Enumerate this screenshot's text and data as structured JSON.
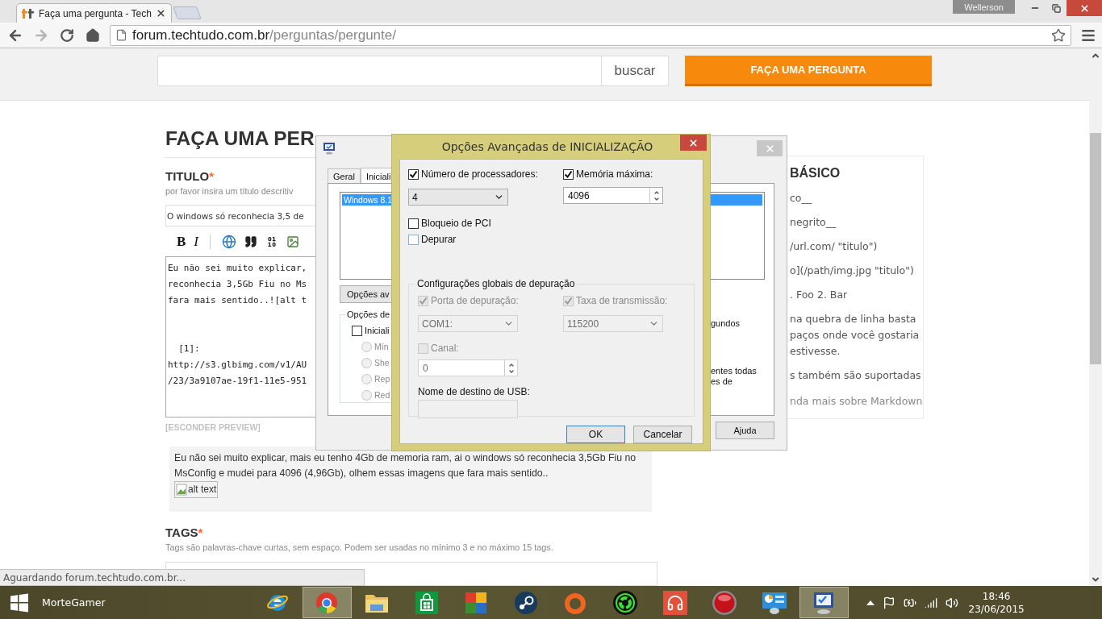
{
  "browser": {
    "tabs": [
      {
        "title": "Faça uma pergunta - Tech",
        "selected": true
      }
    ],
    "user": "Wellerson",
    "url_host": "forum.techtudo.com.br",
    "url_path": "/perguntas/pergunte/",
    "status": "Aguardando forum.techtudo.com.br..."
  },
  "header": {
    "search_button": "buscar",
    "ask_button": "FAÇA UMA PERGUNTA"
  },
  "form": {
    "heading": "FAÇA UMA PER",
    "title_label": "TITULO",
    "required_mark": "*",
    "title_hint": "por favor insira um título descritiv",
    "title_value": "O windows só reconhecia 3,5 de",
    "editor_tools": [
      {
        "kind": "bold",
        "label": "B"
      },
      {
        "kind": "italic",
        "label": "I"
      },
      {
        "kind": "link"
      },
      {
        "kind": "quote"
      },
      {
        "kind": "code"
      },
      {
        "kind": "image"
      }
    ],
    "editor_paragraphs": [
      [
        "Eu não sei muito explicar,",
        "reconhecia 3,5Gb Fiu no Ms",
        "fara mais sentido..![alt t"
      ],
      [
        "  [1]:",
        "http://s3.glbimg.com/v1/AU",
        "/23/3a9107ae-19f1-11e5-951"
      ]
    ],
    "preview_toggle": "[ESCONDER PREVIEW]",
    "preview": {
      "text": "Eu não sei muito explicar, mais eu tenho 4Gb de memoria ram, ai o windows só reconhecia 3,5Gb Fiu no MsConfig e mudei para 4096 (4,96Gb), olhem essas imagens que fara mais sentido..",
      "image_alt": "alt text"
    },
    "tags_label": "TAGS",
    "tags_required_mark": "*",
    "tags_hint": "Tags são palavras-chave curtas, sem espaço. Podem ser usadas no mínimo 3 e no máximo 15 tags."
  },
  "help": {
    "heading": "BÁSICO",
    "lines": [
      "co__",
      "negrito__",
      "/url.com/ \"titulo\")",
      "o](/path/img.jpg \"titulo\")",
      ". Foo 2. Bar",
      "na quebra de linha basta",
      "paços onde você gostaria",
      "estivesse.",
      "s também são suportadas"
    ],
    "link": "nda mais sobre Markdown"
  },
  "msconfig": {
    "tabs": [
      {
        "label": "Geral",
        "selected": false
      },
      {
        "label": "Iniciali",
        "selected": true
      }
    ],
    "boot_entries": [
      {
        "label": "Windows 8.1",
        "selected": true
      }
    ],
    "advanced_button": "Opções av",
    "group_title": "Opções de",
    "safe_boot": {
      "label": "Iniciali",
      "checked": false
    },
    "radios": [
      {
        "label": "Mín",
        "selected": false
      },
      {
        "label": "She",
        "selected": false
      },
      {
        "label": "Rep",
        "selected": false
      },
      {
        "label": "Red",
        "selected": false
      }
    ],
    "right_texts": [
      "gundos",
      "entes todas",
      "es de"
    ],
    "help_button": "Ajuda"
  },
  "dialog": {
    "title": "Opções Avançadas de INICIALIZAÇÃO",
    "processors": {
      "label": "Número de processadores:",
      "checked": true,
      "value": "4"
    },
    "memory": {
      "label": "Memória máxima:",
      "checked": true,
      "value": "4096"
    },
    "pci": {
      "label": "Bloqueio de PCI",
      "checked": false
    },
    "debug": {
      "label": "Depurar",
      "checked": false
    },
    "debug_group": {
      "title": "Configurações globais de depuração",
      "disabled": true,
      "port": {
        "label": "Porta de depuração:",
        "checked": true,
        "value": "COM1:"
      },
      "baud": {
        "label": "Taxa de transmissão:",
        "checked": true,
        "value": "115200"
      },
      "channel": {
        "label": "Canal:",
        "checked": false,
        "value": "0"
      },
      "usb_label": "Nome de destino de USB:"
    },
    "ok": "OK",
    "cancel": "Cancelar"
  },
  "taskbar": {
    "user": "MorteGamer",
    "apps": [
      {
        "kind": "ie",
        "active": false
      },
      {
        "kind": "chrome",
        "active": true
      },
      {
        "kind": "folder",
        "active": false
      },
      {
        "kind": "store",
        "active": false
      },
      {
        "kind": "avg",
        "active": false
      },
      {
        "kind": "steam",
        "active": false
      },
      {
        "kind": "origin",
        "active": false
      },
      {
        "kind": "razer",
        "active": false
      },
      {
        "kind": "headphones",
        "active": false
      },
      {
        "kind": "record",
        "active": false
      },
      {
        "kind": "panel",
        "active": false
      },
      {
        "kind": "msconfig",
        "active": true
      }
    ],
    "time": "18:46",
    "date": "23/06/2015"
  }
}
